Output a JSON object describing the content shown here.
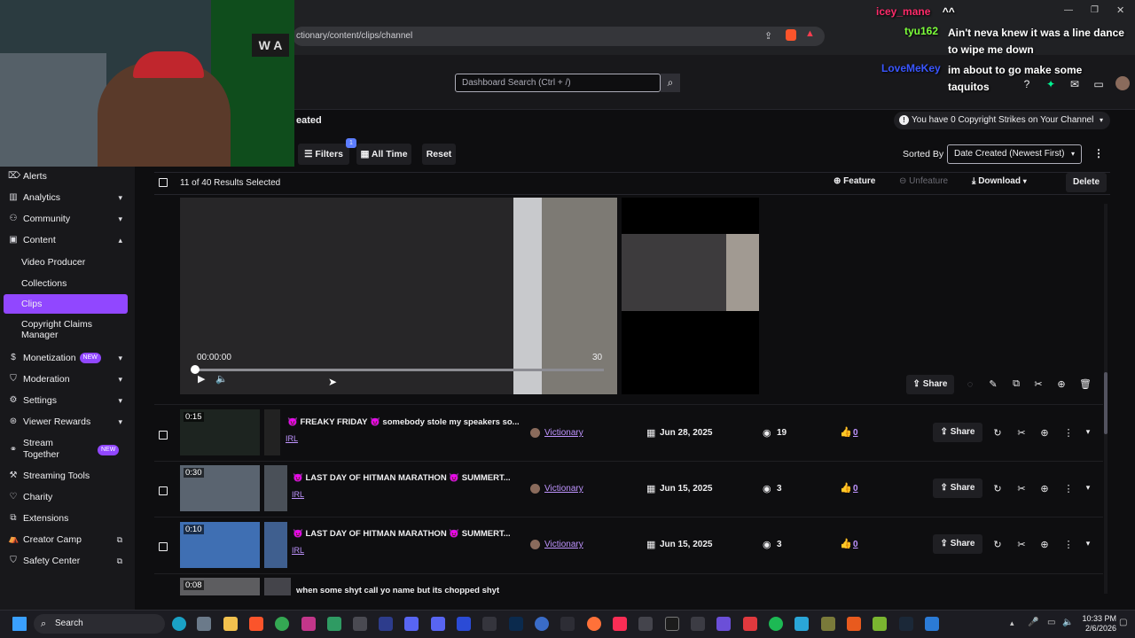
{
  "browser": {
    "url": "ctionary/content/clips/channel"
  },
  "header": {
    "search_placeholder": "Dashboard Search (Ctrl + /)",
    "page_title_fragment": "eated"
  },
  "copyright": {
    "text": "You have 0 Copyright Strikes on Your Channel"
  },
  "toolbar": {
    "filters_label": "Filters",
    "filters_count": "1",
    "all_time_label": "All Time",
    "reset_label": "Reset",
    "sorted_by_label": "Sorted By",
    "sort_value": "Date Created (Newest First)"
  },
  "selection": {
    "summary": "11 of 40 Results Selected",
    "feature_label": "Feature",
    "unfeature_label": "Unfeature",
    "download_label": "Download",
    "delete_label": "Delete"
  },
  "player": {
    "time": "00:00:00",
    "end": "30",
    "share_label": "Share"
  },
  "sidebar": {
    "items": [
      {
        "label": "Alerts",
        "icon": "alert-icon"
      },
      {
        "label": "Analytics",
        "icon": "chart-icon"
      },
      {
        "label": "Community",
        "icon": "people-icon"
      },
      {
        "label": "Content",
        "icon": "content-icon"
      },
      {
        "label": "Video Producer"
      },
      {
        "label": "Collections"
      },
      {
        "label": "Clips"
      },
      {
        "label": "Copyright Claims Manager"
      },
      {
        "label": "Monetization",
        "icon": "money-icon",
        "badge": "NEW"
      },
      {
        "label": "Moderation",
        "icon": "shield-icon"
      },
      {
        "label": "Settings",
        "icon": "gear-icon"
      },
      {
        "label": "Viewer Rewards",
        "icon": "rewards-icon"
      },
      {
        "label": "Stream Together",
        "icon": "together-icon",
        "badge": "NEW"
      },
      {
        "label": "Streaming Tools",
        "icon": "tools-icon"
      },
      {
        "label": "Charity",
        "icon": "charity-icon"
      },
      {
        "label": "Extensions",
        "icon": "extensions-icon"
      },
      {
        "label": "Creator Camp",
        "icon": "camp-icon"
      },
      {
        "label": "Safety Center",
        "icon": "safety-icon"
      }
    ]
  },
  "clips": [
    {
      "duration": "0:15",
      "title": "😈 FREAKY FRIDAY 😈 somebody stole my speakers so...",
      "category": "IRL",
      "creator": "Victionary",
      "date": "Jun 28, 2025",
      "views": "19",
      "likes": "0",
      "share": "Share"
    },
    {
      "duration": "0:30",
      "title": "😈 LAST DAY OF HITMAN MARATHON 😈 SUMMERT...",
      "category": "IRL",
      "creator": "Victionary",
      "date": "Jun 15, 2025",
      "views": "3",
      "likes": "0",
      "share": "Share"
    },
    {
      "duration": "0:10",
      "title": "😈 LAST DAY OF HITMAN MARATHON 😈 SUMMERT...",
      "category": "IRL",
      "creator": "Victionary",
      "date": "Jun 15, 2025",
      "views": "3",
      "likes": "0",
      "share": "Share"
    },
    {
      "duration": "0:08",
      "title": "when some shyt call yo name but its chopped shyt"
    }
  ],
  "chat": [
    {
      "user": "icey_mane",
      "message": "^^"
    },
    {
      "user": "tyu162",
      "message": "Ain't neva knew it was a line dance to wipe me down"
    },
    {
      "user": "LoveMeKey",
      "message": "im about to go make some taquitos"
    }
  ],
  "taskbar": {
    "search_label": "Search",
    "time": "10:33 PM",
    "date": "2/6/2026"
  },
  "colors": {
    "accent": "#9147ff",
    "link": "#bf94ff",
    "background": "#0e0e10"
  }
}
